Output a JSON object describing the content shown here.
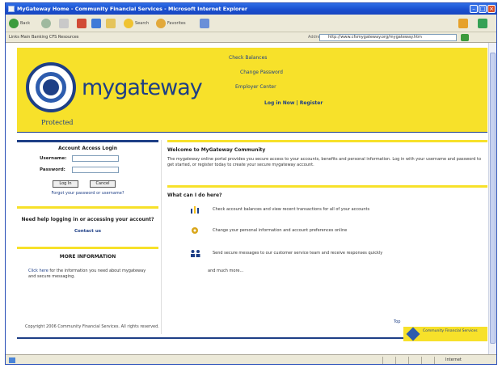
{
  "window": {
    "title": "MyGateway Home - Community Financial Services - Microsoft Internet Explorer"
  },
  "toolbar": {
    "back_label": "Back",
    "search_label": "Search",
    "favorites_label": "Favorites"
  },
  "addressbar": {
    "links_text": "Links   Main   Banking   CFS   Resources",
    "address_label": "Address",
    "address_value": "http://www.cfsmygateway.org/mygateway.htm",
    "go_label": "Go"
  },
  "banner": {
    "logo_word": "mygateway",
    "logo_sub": "Protected",
    "links": [
      "Check Balances",
      "Change Password",
      "Employer Center",
      "Log in Now  | Register"
    ]
  },
  "login": {
    "heading": "Account Access Login",
    "username_label": "Username:",
    "password_label": "Password:",
    "login_button": "Log In",
    "clear_button": "Cancel",
    "forgot_text": "Forgot your password or username?"
  },
  "help": {
    "question": "Need help logging in or accessing your account?",
    "answer": "Contact us"
  },
  "more_info": {
    "heading": "MORE INFORMATION",
    "link_text": "Click here",
    "body": "for the information you need about mygateway and secure messaging."
  },
  "welcome": {
    "heading": "Welcome to MyGateway Community",
    "paragraph": "The mygateway online portal provides you secure access to your accounts, benefits and personal information. Log in with your username and password to get started, or register today to create your secure mygateway account."
  },
  "what_can": {
    "heading": "What can I do here?",
    "features": [
      "Check account balances and view recent transactions for all of your accounts",
      "Change your personal information and account preferences online",
      "Send secure messages to our customer service team and receive responses quickly"
    ],
    "more": "and much more..."
  },
  "footer": {
    "copyright": "Copyright 2006 Community Financial Services. All rights reserved.",
    "top_link": "Top",
    "badge_text": "Community Financial Services"
  },
  "status": {
    "zone": "Internet"
  },
  "colors": {
    "brand_yellow": "#f7e12a",
    "brand_blue": "#1e3f86"
  }
}
